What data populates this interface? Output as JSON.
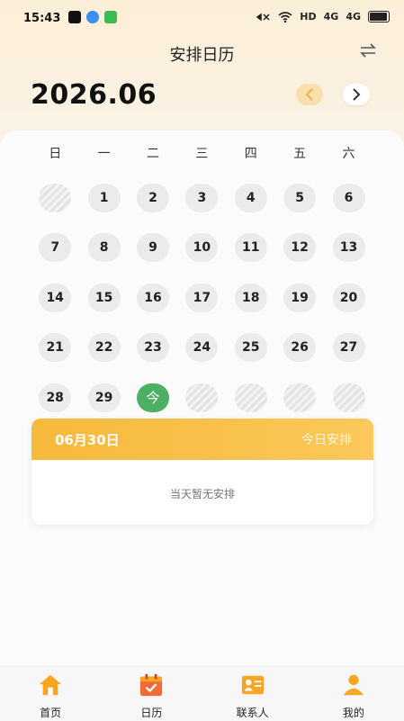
{
  "status_bar": {
    "time": "15:43",
    "network": "HD",
    "signal_1": "4G",
    "signal_2": "4G"
  },
  "header": {
    "title": "安排日历"
  },
  "calendar": {
    "month_label": "2026.06",
    "weekdays": [
      "日",
      "一",
      "二",
      "三",
      "四",
      "五",
      "六"
    ],
    "days": [
      "",
      "1",
      "2",
      "3",
      "4",
      "5",
      "6",
      "7",
      "8",
      "9",
      "10",
      "11",
      "12",
      "13",
      "14",
      "15",
      "16",
      "17",
      "18",
      "19",
      "20",
      "21",
      "22",
      "23",
      "24",
      "25",
      "26",
      "27",
      "28",
      "29",
      "今",
      "",
      "",
      "",
      ""
    ]
  },
  "schedule": {
    "date": "06月30日",
    "tag": "今日安排",
    "empty_text": "当天暂无安排"
  },
  "tabs": [
    {
      "label": "首页",
      "icon": "home-icon"
    },
    {
      "label": "日历",
      "icon": "calendar-icon"
    },
    {
      "label": "联系人",
      "icon": "contacts-icon"
    },
    {
      "label": "我的",
      "icon": "profile-icon"
    }
  ],
  "colors": {
    "accent": "#f6b93b",
    "today": "#4caf62"
  }
}
